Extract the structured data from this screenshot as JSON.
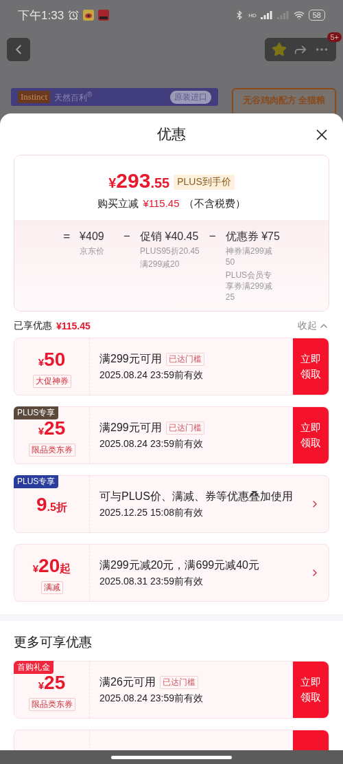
{
  "status_bar": {
    "time": "下午1:33",
    "signal_label": "HD",
    "battery": "58"
  },
  "background_page": {
    "cart_badge": "5+",
    "brand_logo": "Instinct",
    "brand_name": "天然百利$^{®}$",
    "origin_tag": "原装进口",
    "promo_title": "无谷鸡肉配方 全猫粮"
  },
  "sheet": {
    "title": "优惠",
    "summary": {
      "currency": "¥",
      "price_integer": "293",
      "price_decimal": ".55",
      "price_badge": "PLUS到手价",
      "saving_label": "购买立减",
      "saving_amount": "¥115.45",
      "saving_note": "（不含税费）",
      "terms": [
        {
          "operator": "=",
          "value": "¥409",
          "notes": [
            "京东价"
          ]
        },
        {
          "operator": "−",
          "value": "促销 ¥40.45",
          "notes": [
            "PLUS95折20.45",
            "满299减20"
          ]
        },
        {
          "operator": "−",
          "value": "优惠券 ¥75",
          "notes": [
            "神券满299减50",
            "PLUS会员专享券满299减25"
          ]
        }
      ]
    },
    "enjoyed": {
      "label": "已享优惠",
      "amount": "¥115.45",
      "collapse": "收起",
      "expanded": true
    },
    "coupons": [
      {
        "kind": "claim",
        "prefix": "¥",
        "amount": "50",
        "tag": "大促神券",
        "condition": "满299元可用",
        "threshold": "已达门槛",
        "expiry": "2025.08.24 23:59前有效",
        "action": "立即领取"
      },
      {
        "kind": "claim",
        "badge": "PLUS专享",
        "color": "#5b4a3b",
        "prefix": "¥",
        "amount": "25",
        "tag": "限品类东券",
        "condition": "满299元可用",
        "threshold": "已达门槛",
        "expiry": "2025.08.24 23:59前有效",
        "action": "立即领取"
      },
      {
        "kind": "info",
        "badge": "PLUS专享",
        "color": "#2a3d9c",
        "amount": "9",
        "suffix": ".5折",
        "condition": "可与PLUS价、满减、券等优惠叠加使用",
        "expiry": "2025.12.25 15:08前有效"
      },
      {
        "kind": "info",
        "prefix": "¥",
        "amount": "20",
        "suffix": "起",
        "tag": "满减",
        "condition": "满299元减20元，满699元减40元",
        "expiry": "2025.08.31 23:59前有效"
      }
    ],
    "more_title": "更多可享优惠",
    "more_coupons": [
      {
        "kind": "claim",
        "badge": "首购礼金",
        "color": "#f0263c",
        "prefix": "¥",
        "amount": "25",
        "tag": "限品类东券",
        "condition": "满26元可用",
        "threshold": "已达门槛",
        "expiry": "2025.08.24 23:59前有效",
        "action": "立即领取"
      },
      {
        "kind": "stub"
      }
    ]
  }
}
